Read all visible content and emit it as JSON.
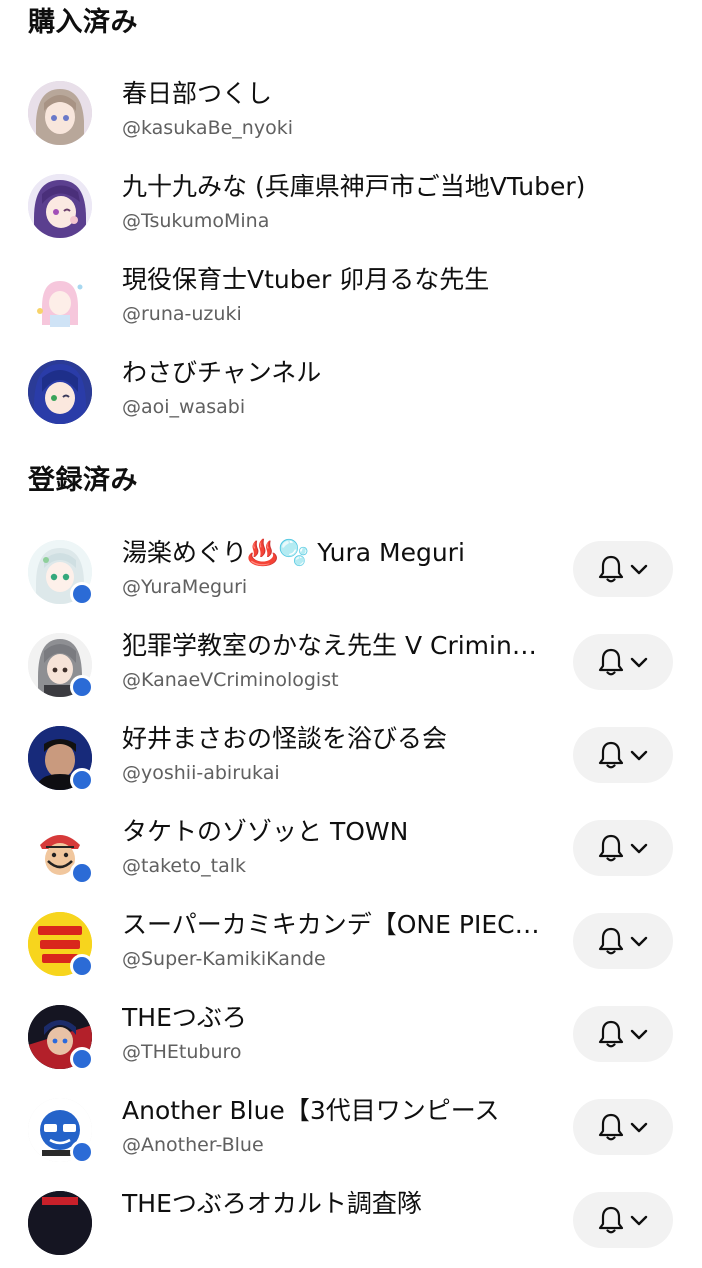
{
  "sections": {
    "purchased": {
      "title": "購入済み",
      "items": [
        {
          "name": "春日部つくし",
          "handle": "@kasukaBe_nyoki"
        },
        {
          "name": "九十九みな (兵庫県神戸市ご当地VTuber)",
          "handle": "@TsukumoMina"
        },
        {
          "name": "現役保育士Vtuber 卯月るな先生",
          "handle": "@runa-uzuki"
        },
        {
          "name": "わさびチャンネル",
          "handle": "@aoi_wasabi"
        }
      ]
    },
    "subscribed": {
      "title": "登録済み",
      "items": [
        {
          "name": "湯楽めぐり♨️🫧 Yura Meguri",
          "handle": "@YuraMeguri"
        },
        {
          "name": "犯罪学教室のかなえ先生 V Criminologist",
          "handle": "@KanaeVCriminologist"
        },
        {
          "name": "好井まさおの怪談を浴びる会",
          "handle": "@yoshii-abirukai"
        },
        {
          "name": "タケトのゾゾッと TOWN",
          "handle": "@taketo_talk"
        },
        {
          "name": "スーパーカミキカンデ【ONE PIECE】",
          "handle": "@Super-KamikiKande"
        },
        {
          "name": "THEつぶろ",
          "handle": "@THEtuburo"
        },
        {
          "name": "Another Blue【3代目ワンピース",
          "handle": "@Another-Blue"
        },
        {
          "name": "THEつぶろオカルト調査隊",
          "handle": ""
        }
      ]
    }
  },
  "icons": {
    "notification": "bell-icon",
    "dropdown": "chevron-down-icon"
  },
  "colors": {
    "new_content_dot": "#2b6bd6",
    "handle_text": "#606060",
    "bell_button_bg": "#f2f2f2"
  }
}
